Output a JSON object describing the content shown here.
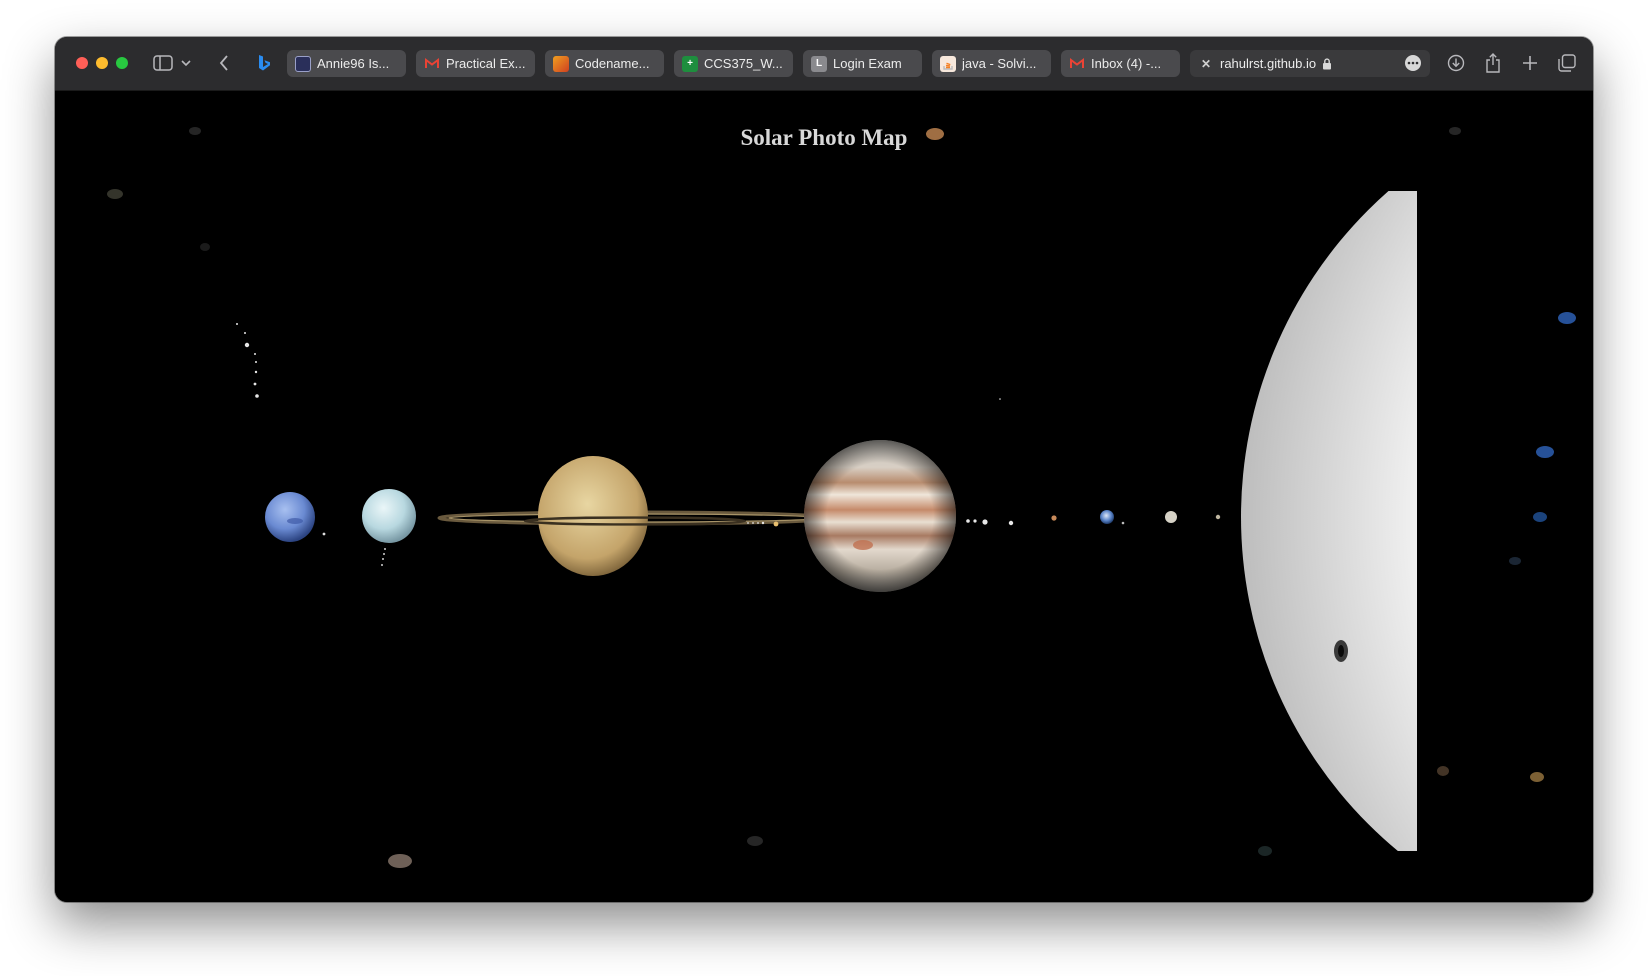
{
  "browser": {
    "tabs": [
      {
        "label": "Annie96 Is...",
        "favicon": "document-icon",
        "color": "#2a2f5a"
      },
      {
        "label": "Practical Ex...",
        "favicon": "gmail-icon",
        "color": "#ea4335"
      },
      {
        "label": "Codename...",
        "favicon": "codename-icon",
        "color": "#f0a020"
      },
      {
        "label": "CCS375_W...",
        "favicon": "sheets-icon",
        "color": "#1e8e3e"
      },
      {
        "label": "Login Exam",
        "favicon": "letter-l-icon",
        "color": "#8a8a8e",
        "letter": "L"
      },
      {
        "label": "java - Solvi...",
        "favicon": "stackoverflow-icon",
        "color": "#f48024"
      },
      {
        "label": "Inbox (4) -...",
        "favicon": "gmail-icon",
        "color": "#ea4335"
      },
      {
        "label": "rahulrst.github.io",
        "favicon": "close-tab-icon",
        "color": "#3a3a3c",
        "active": true
      }
    ]
  },
  "page": {
    "title": "Solar Photo Map"
  }
}
